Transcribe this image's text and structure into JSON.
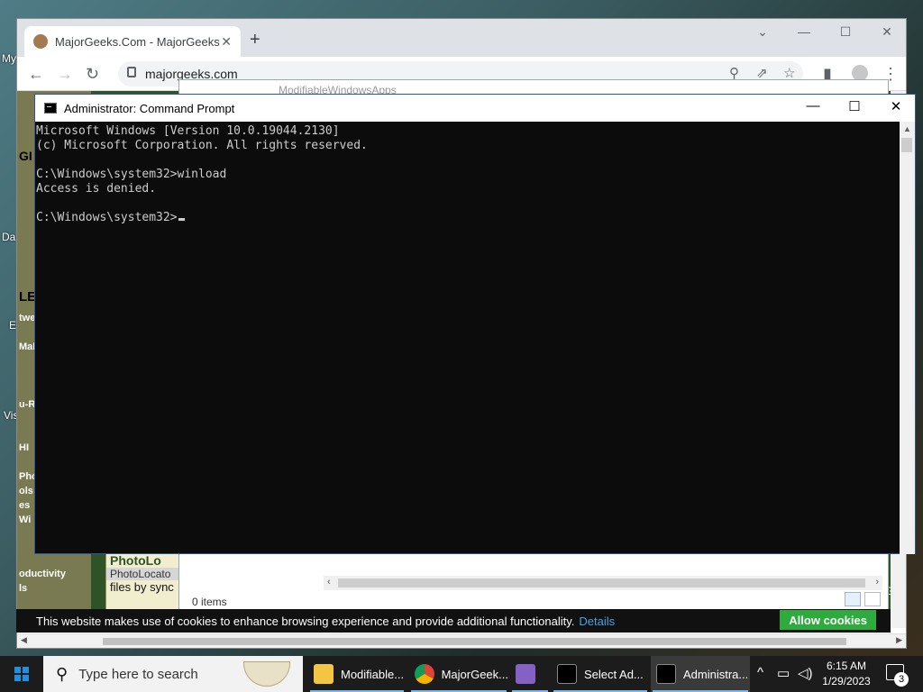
{
  "desktop": {
    "icon_labels": [
      "My",
      "Da",
      "E",
      "Vis"
    ]
  },
  "chrome": {
    "tab_title": "MajorGeeks.Com - MajorGeeks",
    "tab_close": "✕",
    "new_tab": "+",
    "url": "majorgeeks.com",
    "controls": {
      "dropdown": "⌄",
      "minimize": "—",
      "maximize": "☐",
      "close": "✕"
    },
    "content": {
      "sidebar_labels": [
        "GI",
        "LE",
        "tweal",
        "Mal",
        "u-Ra",
        "HI",
        "Pho",
        "ols",
        "es",
        "Wi",
        "oductivity",
        "ls"
      ],
      "photo_title": "PhotoLo",
      "photo_link": "PhotoLocato",
      "photo_desc": "files by sync",
      "partial_right": "G"
    },
    "cookie_bar": {
      "message": "This website makes use of cookies to enhance browsing experience and provide additional functionality.",
      "details_link": "Details",
      "allow_button": "Allow cookies"
    }
  },
  "explorer": {
    "title": "ModifiableWindowsApps",
    "status": "0 items"
  },
  "cmd": {
    "title": "Administrator: Command Prompt",
    "lines": [
      "Microsoft Windows [Version 10.0.19044.2130]",
      "(c) Microsoft Corporation. All rights reserved.",
      "",
      "C:\\Windows\\system32>winload",
      "Access is denied.",
      "",
      "C:\\Windows\\system32>"
    ],
    "controls": {
      "minimize": "—",
      "maximize": "☐",
      "close": "✕"
    }
  },
  "taskbar": {
    "search_placeholder": "Type here to search",
    "items": [
      {
        "label": "Modifiable...",
        "icon": "folder-icon",
        "color": "#f4c542"
      },
      {
        "label": "MajorGeek...",
        "icon": "chrome-icon",
        "color": "#db4437"
      },
      {
        "label": "",
        "icon": "visual-studio-icon",
        "color": "#8661c5"
      },
      {
        "label": "Select Ad...",
        "icon": "cmd-icon",
        "color": "#000000"
      },
      {
        "label": "Administra...",
        "icon": "cmd-icon",
        "color": "#000000"
      }
    ],
    "time": "6:15 AM",
    "date": "1/29/2023",
    "notification_count": "3"
  }
}
